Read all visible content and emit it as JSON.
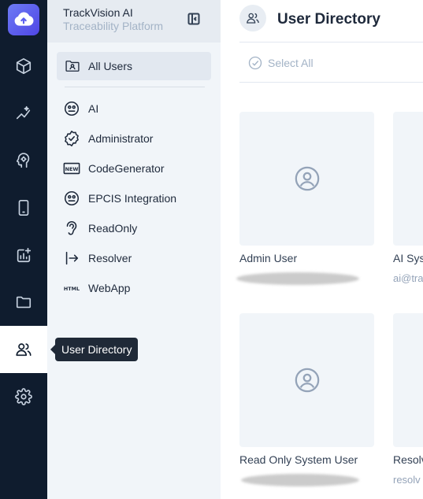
{
  "app": {
    "name": "TrackVision AI",
    "subtitle": "Traceability Platform"
  },
  "rail": {
    "items": [
      {
        "icon": "cube-icon"
      },
      {
        "icon": "sparkle-chart-icon"
      },
      {
        "icon": "brain-gear-icon"
      },
      {
        "icon": "mobile-icon"
      },
      {
        "icon": "analytics-icon"
      },
      {
        "icon": "folder-icon"
      },
      {
        "icon": "users-icon",
        "active": true
      },
      {
        "icon": "gear-icon"
      }
    ],
    "tooltip": "User Directory"
  },
  "sidebar": {
    "all_users": "All Users",
    "groups": [
      {
        "label": "AI",
        "icon": "ai-face-icon"
      },
      {
        "label": "Administrator",
        "icon": "badge-check-icon"
      },
      {
        "label": "CodeGenerator",
        "icon": "new-badge-icon"
      },
      {
        "label": "EPCIS Integration",
        "icon": "ai-face-icon"
      },
      {
        "label": "ReadOnly",
        "icon": "ear-icon"
      },
      {
        "label": "Resolver",
        "icon": "arrow-bar-right-icon"
      },
      {
        "label": "WebApp",
        "icon": "html-icon"
      }
    ]
  },
  "main": {
    "title": "User Directory",
    "select_all": "Select All",
    "users": [
      {
        "name": "Admin User",
        "email": ""
      },
      {
        "name": "AI Sys",
        "email": "ai@tra"
      },
      {
        "name": "Read Only System User",
        "email": ""
      },
      {
        "name": "Resolv",
        "email": "resolv"
      }
    ]
  },
  "colors": {
    "rail_bg": "#0f1c2e",
    "sidebar_bg": "#f1f5f9",
    "accent": "#5b5ff0"
  }
}
